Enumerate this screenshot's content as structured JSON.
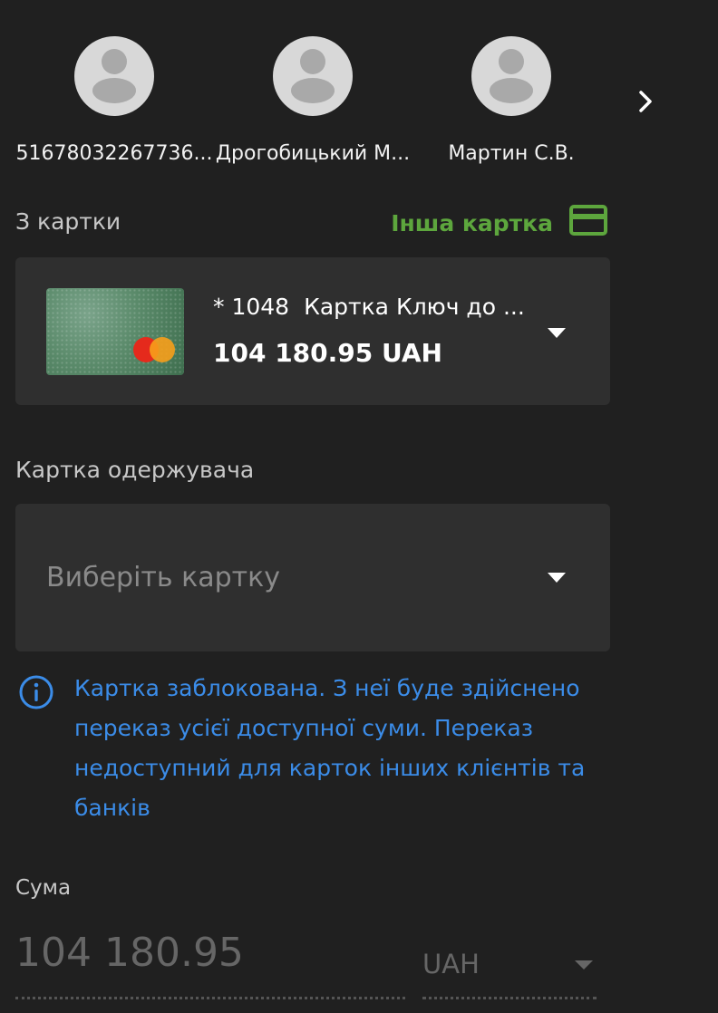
{
  "contacts": [
    {
      "name": "51678032267736..."
    },
    {
      "name": "Дрогобицький М..."
    },
    {
      "name": "Мартин С.В."
    }
  ],
  "source": {
    "label": "З картки",
    "other_card_label": "Інша картка",
    "card": {
      "number": "* 1048",
      "name": "Картка Ключ до ...",
      "balance": "104 180.95 UAH"
    }
  },
  "recipient": {
    "label": "Картка одержувача",
    "placeholder": "Виберіть картку"
  },
  "info": {
    "text": "Картка заблокована. З неї буде здійснено переказ усієї доступної суми. Переказ недоступний для карток інших клієнтів та банків"
  },
  "amount": {
    "label": "Сума",
    "value": "104 180.95",
    "currency": "UAH"
  },
  "colors": {
    "accent_green": "#5da63d",
    "info_blue": "#3b8ce8",
    "background": "#202020",
    "panel": "#2f2f2f"
  }
}
